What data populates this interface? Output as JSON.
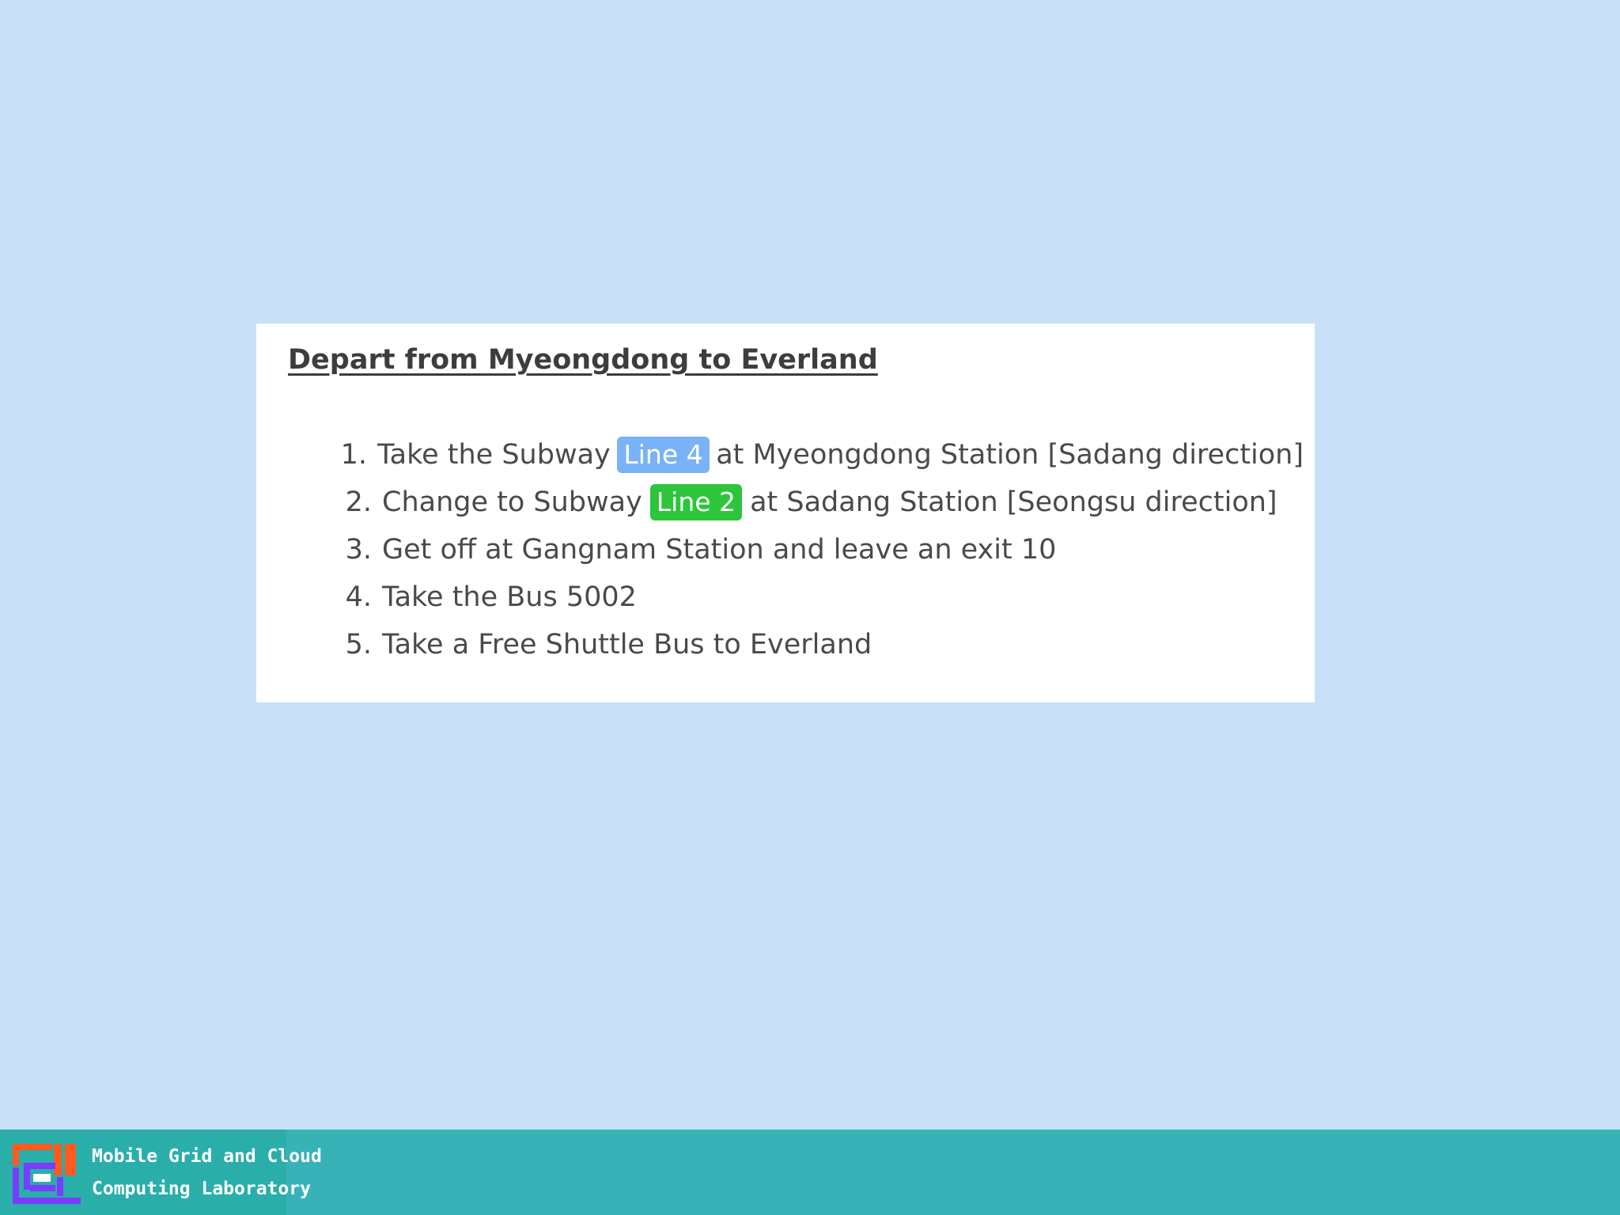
{
  "card": {
    "title": "Depart from Myeongdong to Everland",
    "steps": [
      {
        "num": "1.",
        "before": "Take the Subway",
        "badge": "Line 4",
        "after": "at Myeongdong Station [Sadang direction]"
      },
      {
        "num": "2.",
        "before": "Change to Subway",
        "badge": "Line 2",
        "after": "at Sadang Station [Seongsu direction]"
      },
      {
        "num": "3.",
        "text": "Get off at Gangnam Station and leave an exit 10"
      },
      {
        "num": "4.",
        "text": "Take the Bus 5002"
      },
      {
        "num": "5.",
        "text": "Take a Free Shuttle Bus to Everland"
      }
    ]
  },
  "footer": {
    "lab_name_line1": "Mobile Grid and Cloud",
    "lab_name_line2": "Computing Laboratory"
  },
  "colors": {
    "background": "#c8e1f8",
    "line4_badge": "#79b2f6",
    "line2_badge": "#2dc53b",
    "footer": "#37b3b8"
  },
  "icons": {
    "lab_logo": "lab-logo-icon"
  }
}
